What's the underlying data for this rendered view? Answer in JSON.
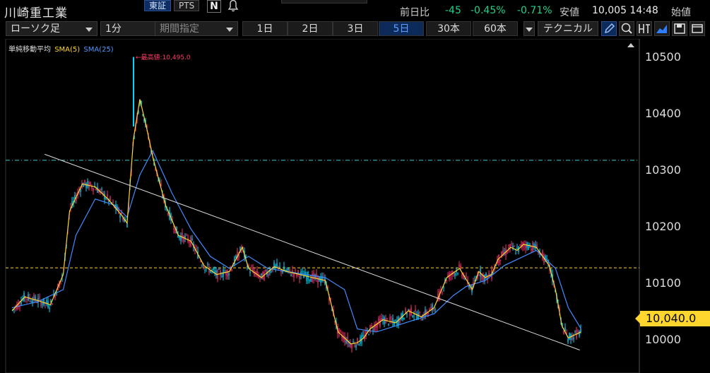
{
  "header": {
    "stock_name": "川崎重工業",
    "exchange_tabs": [
      "東証",
      "PTS"
    ],
    "flag_label": "N",
    "quote": {
      "prev_day_label": "前日比",
      "change": "-45",
      "change_pct": "-0.45%",
      "low_pct": "-0.71%",
      "low_label": "安値",
      "price_time": "10,005 14:48",
      "start_label": "始値"
    }
  },
  "toolbar": {
    "chart_type": "ローソク足",
    "interval": "1分",
    "period_select": "期間指定",
    "ranges": [
      "1日",
      "2日",
      "3日",
      "5日",
      "30本",
      "60本"
    ],
    "active_range": "5日",
    "technical": "テクニカル",
    "icons": [
      "pen-icon",
      "zoom-icon",
      "output-icon",
      "area-chart-icon",
      "save-icon",
      "window-icon"
    ]
  },
  "legend": {
    "title": "単純移動平均",
    "sma5": "SMA(5)",
    "sma25": "SMA(25)"
  },
  "annotations": {
    "max_note": "←最高値:10,495.0",
    "current_price": "10,040.0"
  },
  "colors": {
    "up": "#00d7ff",
    "down": "#ff2d6f",
    "sma5": "#ffd62e",
    "sma25": "#3f8cff",
    "hline_cyan": "#39c9c9",
    "hline_yellow": "#ffd62e",
    "trendline": "#d8d8d8",
    "active_tab": "#5f9cff"
  },
  "chart_data": {
    "type": "line",
    "title": "",
    "xlabel": "",
    "ylabel": "",
    "ylim": [
      9972,
      10525
    ],
    "y_ticks": [
      "10500",
      "10400",
      "10300",
      "10200",
      "10100",
      "10000"
    ],
    "hlines": [
      10324,
      10146
    ],
    "trendline": {
      "x": [
        0.061,
        0.898
      ],
      "y": [
        10334,
        10010
      ]
    },
    "series": [
      {
        "name": "SMA(5)",
        "x": [
          0.01,
          0.03,
          0.05,
          0.07,
          0.09,
          0.1,
          0.12,
          0.14,
          0.16,
          0.18,
          0.19,
          0.2,
          0.21,
          0.22,
          0.23,
          0.25,
          0.27,
          0.29,
          0.31,
          0.33,
          0.35,
          0.37,
          0.38,
          0.4,
          0.42,
          0.44,
          0.46,
          0.48,
          0.5,
          0.52,
          0.54,
          0.55,
          0.56,
          0.57,
          0.59,
          0.61,
          0.63,
          0.65,
          0.67,
          0.69,
          0.71,
          0.73,
          0.74,
          0.75,
          0.76,
          0.77,
          0.79,
          0.8,
          0.81,
          0.83,
          0.85,
          0.86,
          0.87,
          0.88,
          0.89,
          0.9
        ],
        "values": [
          10075,
          10098,
          10092,
          10085,
          10135,
          10240,
          10285,
          10280,
          10260,
          10235,
          10220,
          10360,
          10425,
          10380,
          10330,
          10250,
          10200,
          10190,
          10150,
          10135,
          10140,
          10180,
          10145,
          10130,
          10148,
          10140,
          10135,
          10130,
          10125,
          10040,
          10020,
          10022,
          10030,
          10045,
          10060,
          10055,
          10075,
          10065,
          10080,
          10130,
          10145,
          10110,
          10140,
          10130,
          10135,
          10160,
          10180,
          10175,
          10185,
          10180,
          10150,
          10110,
          10050,
          10030,
          10035,
          10040
        ]
      },
      {
        "name": "SMA(25)",
        "x": [
          0.01,
          0.05,
          0.09,
          0.11,
          0.14,
          0.17,
          0.19,
          0.21,
          0.23,
          0.26,
          0.29,
          0.32,
          0.35,
          0.38,
          0.41,
          0.44,
          0.47,
          0.5,
          0.53,
          0.55,
          0.58,
          0.61,
          0.64,
          0.67,
          0.7,
          0.72,
          0.75,
          0.78,
          0.81,
          0.83,
          0.86,
          0.88,
          0.9
        ],
        "values": [
          10080,
          10090,
          10110,
          10200,
          10260,
          10250,
          10230,
          10300,
          10340,
          10270,
          10210,
          10165,
          10145,
          10165,
          10145,
          10140,
          10135,
          10130,
          10110,
          10045,
          10040,
          10050,
          10060,
          10070,
          10100,
          10115,
          10125,
          10150,
          10165,
          10175,
          10145,
          10080,
          10045
        ]
      }
    ]
  }
}
